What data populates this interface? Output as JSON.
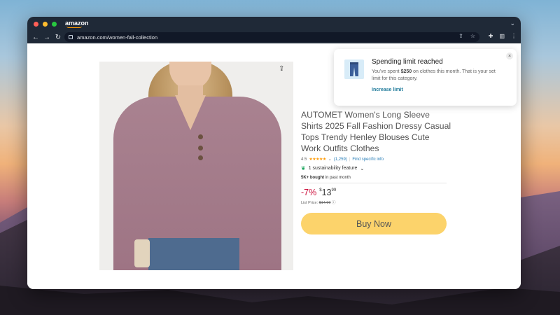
{
  "browser": {
    "tab_title": "amazon",
    "url": "amazon.com/women-fall-collection",
    "nav": {
      "back": "←",
      "forward": "→",
      "reload": "↻"
    },
    "icons": [
      "share-icon",
      "star-icon",
      "extensions-icon",
      "sidebar-icon",
      "menu-icon"
    ]
  },
  "product": {
    "title": "AUTOMET Women's Long Sleeve Shirts 2025 Fall Fashion Dressy Casual Tops Trendy Henley Blouses Cute Work Outfits Clothes",
    "rating": "4.5",
    "stars": "★★★★★",
    "review_count": "(1,259)",
    "find_specific_info": "Find specific info",
    "sustainability": "1 sustainability feature",
    "bought_count": "5K+ bought",
    "bought_suffix": "in past month",
    "discount": "-7%",
    "currency": "$",
    "price_whole": "13",
    "price_cents": "99",
    "list_price_label": "List Price:",
    "list_price": "$14.99",
    "buy_button": "Buy Now"
  },
  "toast": {
    "title": "Spending limit reached",
    "body_prefix": "You've spent ",
    "amount": "$250",
    "body_suffix": " on clothes this month. That is your set limit for this category.",
    "link": "Increase limit",
    "close": "×"
  },
  "colors": {
    "accent": "#ff9900",
    "buy_button": "#fcd36b",
    "discount": "#cc0c39",
    "link": "#2a7fb8"
  }
}
